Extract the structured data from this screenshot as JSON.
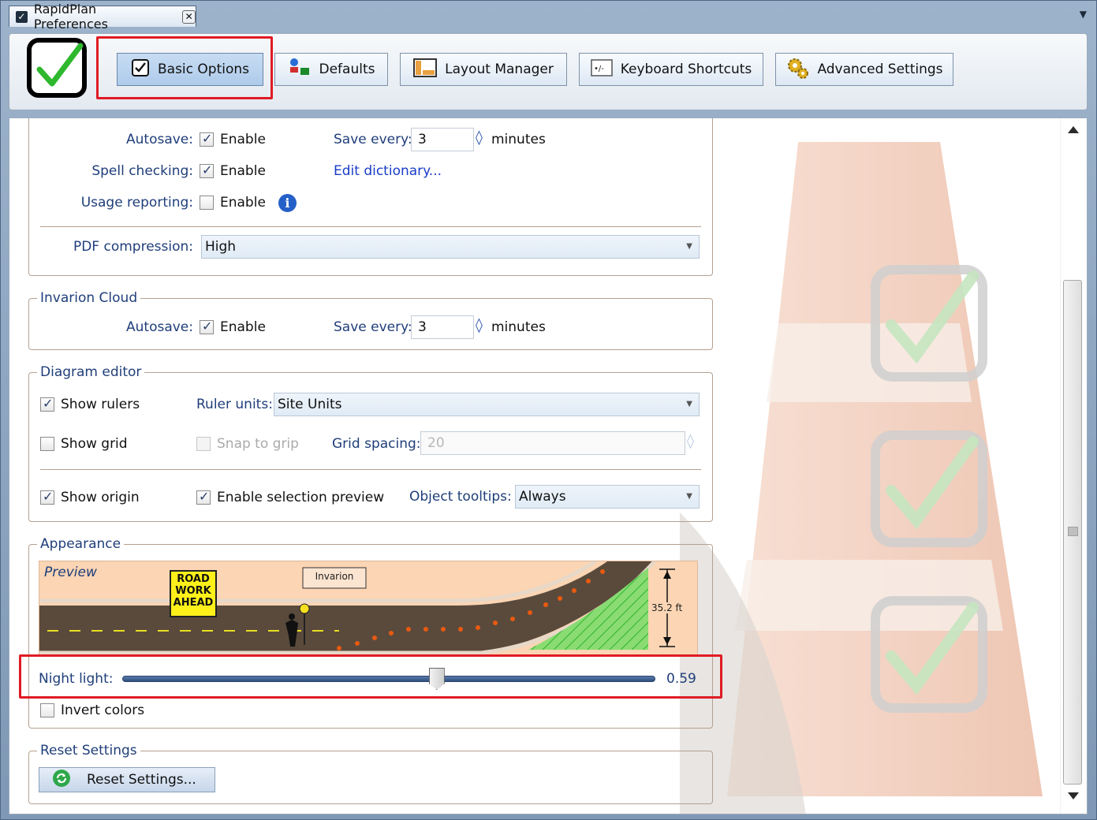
{
  "window": {
    "tab_title": "RapidPlan Preferences",
    "close_glyph": "✕",
    "menu_glyph": "▼"
  },
  "toolbar": {
    "buttons": [
      {
        "label": "Basic Options",
        "icon": "checkbox-icon",
        "active": true
      },
      {
        "label": "Defaults",
        "icon": "defaults-icon"
      },
      {
        "label": "Layout Manager",
        "icon": "layout-icon"
      },
      {
        "label": "Keyboard Shortcuts",
        "icon": "keyboard-icon"
      },
      {
        "label": "Advanced Settings",
        "icon": "gears-icon"
      }
    ]
  },
  "general": {
    "autosave_label": "Autosave:",
    "autosave_enable": "Enable",
    "autosave_checked": true,
    "save_every_label": "Save every:",
    "save_every_value": "3",
    "minutes": "minutes",
    "spell_label": "Spell checking:",
    "spell_enable": "Enable",
    "spell_checked": true,
    "edit_dictionary": "Edit dictionary...",
    "usage_label": "Usage reporting:",
    "usage_enable": "Enable",
    "usage_checked": false,
    "pdf_label": "PDF compression:",
    "pdf_value": "High"
  },
  "cloud": {
    "title": "Invarion Cloud",
    "autosave_label": "Autosave:",
    "autosave_enable": "Enable",
    "save_every_label": "Save every:",
    "save_every_value": "3",
    "minutes": "minutes"
  },
  "diagram": {
    "title": "Diagram editor",
    "show_rulers": "Show rulers",
    "ruler_units_label": "Ruler units:",
    "ruler_units_value": "Site Units",
    "show_grid": "Show grid",
    "snap_to_grip": "Snap to grip",
    "grid_spacing_label": "Grid spacing:",
    "grid_spacing_value": "20",
    "show_origin": "Show origin",
    "selection_preview": "Enable selection preview",
    "tooltips_label": "Object tooltips:",
    "tooltips_value": "Always"
  },
  "appearance": {
    "title": "Appearance",
    "preview_label": "Preview",
    "sign_text": [
      "ROAD",
      "WORK",
      "AHEAD"
    ],
    "banner": "Invarion",
    "dimension": "35.2 ft",
    "night_light_label": "Night light:",
    "night_light_value": "0.59",
    "night_light_fraction": 0.59,
    "invert_colors": "Invert colors"
  },
  "reset": {
    "title": "Reset Settings",
    "button": "Reset Settings..."
  },
  "colors": {
    "highlight": "#e01b24",
    "label_blue": "#1f3e7a",
    "link_blue": "#1a3cc8"
  }
}
